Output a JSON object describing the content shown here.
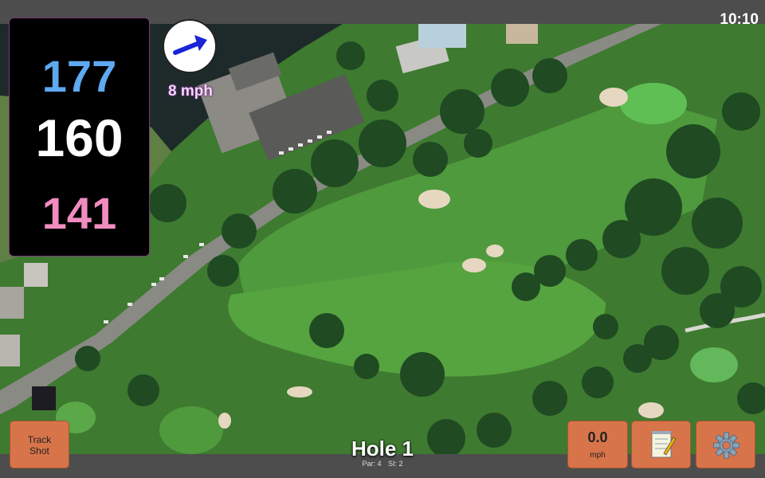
{
  "status_bar": {
    "time": "10:10"
  },
  "distances": {
    "back": "177",
    "middle": "160",
    "front": "141"
  },
  "wind": {
    "speed_label": "8 mph",
    "icon": "wind-arrow-icon"
  },
  "hole": {
    "title": "Hole 1",
    "par_label": "Par: 4",
    "si_label": "SI: 2"
  },
  "buttons": {
    "track_shot": {
      "line1": "Track",
      "line2": "Shot"
    },
    "speed": {
      "value": "0.0",
      "unit": "mph"
    },
    "notes_icon": "notepad-icon",
    "settings_icon": "gear-icon"
  },
  "colors": {
    "back_distance": "#5ea9f0",
    "middle_distance": "#ffffff",
    "front_distance": "#f08cc0",
    "button": "#d8744a",
    "fairway": "#4f9a3c"
  }
}
